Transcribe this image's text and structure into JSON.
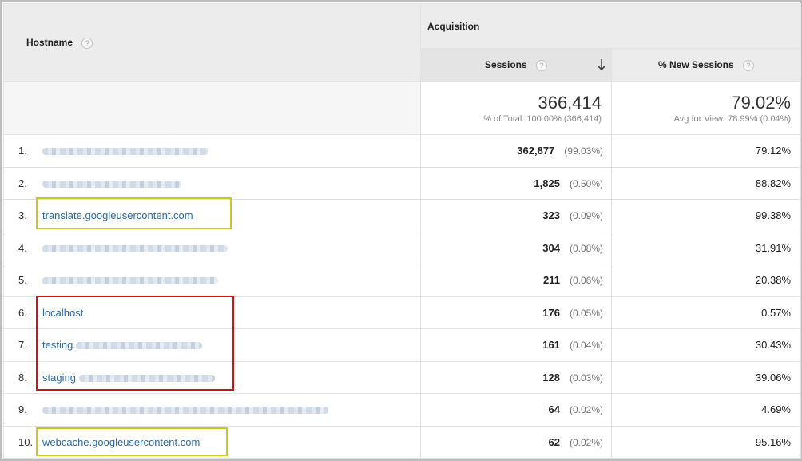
{
  "header": {
    "hostname_label": "Hostname",
    "help_glyph": "?",
    "group_label": "Acquisition",
    "sessions_label": "Sessions",
    "new_sessions_label": "% New Sessions",
    "sort_icon": "arrow-down-icon"
  },
  "totals": {
    "sessions": "366,414",
    "sessions_sub": "% of Total: 100.00% (366,414)",
    "new_sessions": "79.02%",
    "new_sessions_sub": "Avg for View: 78.99% (0.04%)"
  },
  "rows": [
    {
      "num": "1.",
      "host": "",
      "sessions": "362,877",
      "pct": "(99.03%)",
      "new": "79.12%"
    },
    {
      "num": "2.",
      "host": "",
      "sessions": "1,825",
      "pct": "(0.50%)",
      "new": "88.82%"
    },
    {
      "num": "3.",
      "host": "translate.googleusercontent.com",
      "sessions": "323",
      "pct": "(0.09%)",
      "new": "99.38%"
    },
    {
      "num": "4.",
      "host": "",
      "sessions": "304",
      "pct": "(0.08%)",
      "new": "31.91%"
    },
    {
      "num": "5.",
      "host": "",
      "sessions": "211",
      "pct": "(0.06%)",
      "new": "20.38%"
    },
    {
      "num": "6.",
      "host": "localhost",
      "sessions": "176",
      "pct": "(0.05%)",
      "new": "0.57%"
    },
    {
      "num": "7.",
      "host": "testing.",
      "sessions": "161",
      "pct": "(0.04%)",
      "new": "30.43%"
    },
    {
      "num": "8.",
      "host": "staging",
      "sessions": "128",
      "pct": "(0.03%)",
      "new": "39.06%"
    },
    {
      "num": "9.",
      "host": "",
      "sessions": "64",
      "pct": "(0.02%)",
      "new": "4.69%"
    },
    {
      "num": "10.",
      "host": "webcache.googleusercontent.com",
      "sessions": "62",
      "pct": "(0.02%)",
      "new": "95.16%"
    }
  ],
  "colors": {
    "link": "#2a6aa8",
    "highlight_yellow": "#c8c81e",
    "highlight_red": "#c8161d",
    "header_bg": "#ececec"
  }
}
